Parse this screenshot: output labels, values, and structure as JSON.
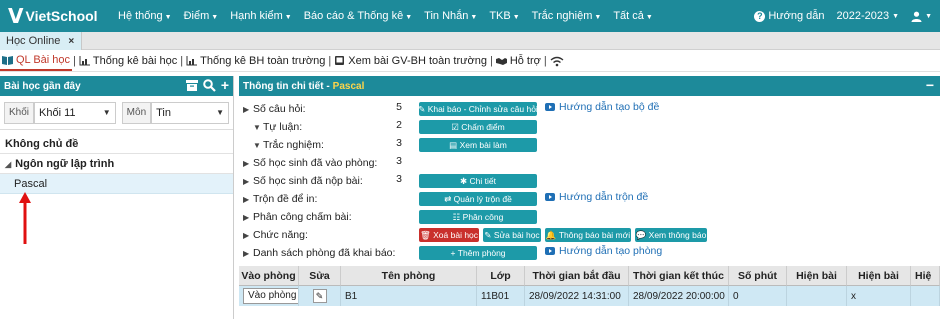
{
  "app": {
    "logo_text": "VietSchool",
    "logo_mark": "V"
  },
  "top_menu": [
    "Hệ thống",
    "Điểm",
    "Hạnh kiểm",
    "Báo cáo & Thống kê",
    "Tin Nhắn",
    "TKB",
    "Trắc nghiệm",
    "Tất cả"
  ],
  "top_right": {
    "help": "Hướng dẫn",
    "year": "2022-2023"
  },
  "tab": {
    "label": "Học Online",
    "close": "×"
  },
  "subnav": [
    {
      "label": "QL Bài học",
      "icon": "book-icon"
    },
    {
      "label": "Thống kê bài học",
      "icon": "chart-icon"
    },
    {
      "label": "Thống kê BH toàn trường",
      "icon": "chart-icon"
    },
    {
      "label": "Xem bài GV-BH toàn trường",
      "icon": "monitor-icon"
    },
    {
      "label": "Hỗ trợ",
      "icon": "handshake-icon"
    }
  ],
  "left": {
    "title": "Bài học gần đây",
    "filters": {
      "khoi_label": "Khối",
      "khoi_value": "Khối 11",
      "mon_label": "Môn",
      "mon_value": "Tin"
    },
    "tree": {
      "group": "Không chủ đề",
      "node": "Ngôn ngữ lập trình",
      "leaf": "Pascal"
    }
  },
  "right": {
    "title": "Thông tin chi tiết - ",
    "title_accent": "Pascal",
    "rows": [
      {
        "label": "Số câu hỏi:",
        "value": "5"
      },
      {
        "label": "Tự luận:",
        "value": "2"
      },
      {
        "label": "Trắc nghiệm:",
        "value": "3"
      },
      {
        "label": "Số học sinh đã vào phòng:",
        "value": "3"
      },
      {
        "label": "Số học sinh đã nộp bài:",
        "value": "3"
      },
      {
        "label": "Trộn đề để in:",
        "value": ""
      },
      {
        "label": "Phân công chấm bài:",
        "value": ""
      },
      {
        "label": "Chức năng:",
        "value": ""
      },
      {
        "label": "Danh sách phòng đã khai báo:",
        "value": ""
      }
    ],
    "buttons": {
      "khai_bao": "Khai báo - Chỉnh sửa câu hỏi",
      "cham_diem": "Chấm điểm",
      "xem_bai_lam": "Xem bài làm",
      "chi_tiet": "Chi tiết",
      "quan_ly_tron_de": "Quản lý trộn đề",
      "phan_cong": "Phân công",
      "xoa_bai_hoc": "Xoá bài học",
      "sua_bai_hoc": "Sửa bài học",
      "thong_bao_bai_moi": "Thông báo bài mới",
      "xem_thong_bao": "Xem thông báo",
      "them_phong": "Thêm phòng"
    },
    "links": {
      "tao_bo_de": "Hướng dẫn tạo bộ đề",
      "tron_de": "Hướng dẫn trộn đề",
      "tao_phong": "Hướng dẫn tạo phòng"
    },
    "table": {
      "headers": [
        "Vào phòng",
        "Sửa",
        "Tên phòng",
        "Lớp",
        "Thời gian bắt đầu",
        "Thời gian kết thúc",
        "Số phút",
        "Hiện bài",
        "Hiện bài",
        "Hiệ"
      ],
      "rows": [
        [
          "Vào phòng",
          "",
          "B1",
          "11B01",
          "28/09/2022 14:31:00",
          "28/09/2022 20:00:00",
          "0",
          "",
          "x",
          ""
        ]
      ]
    }
  }
}
